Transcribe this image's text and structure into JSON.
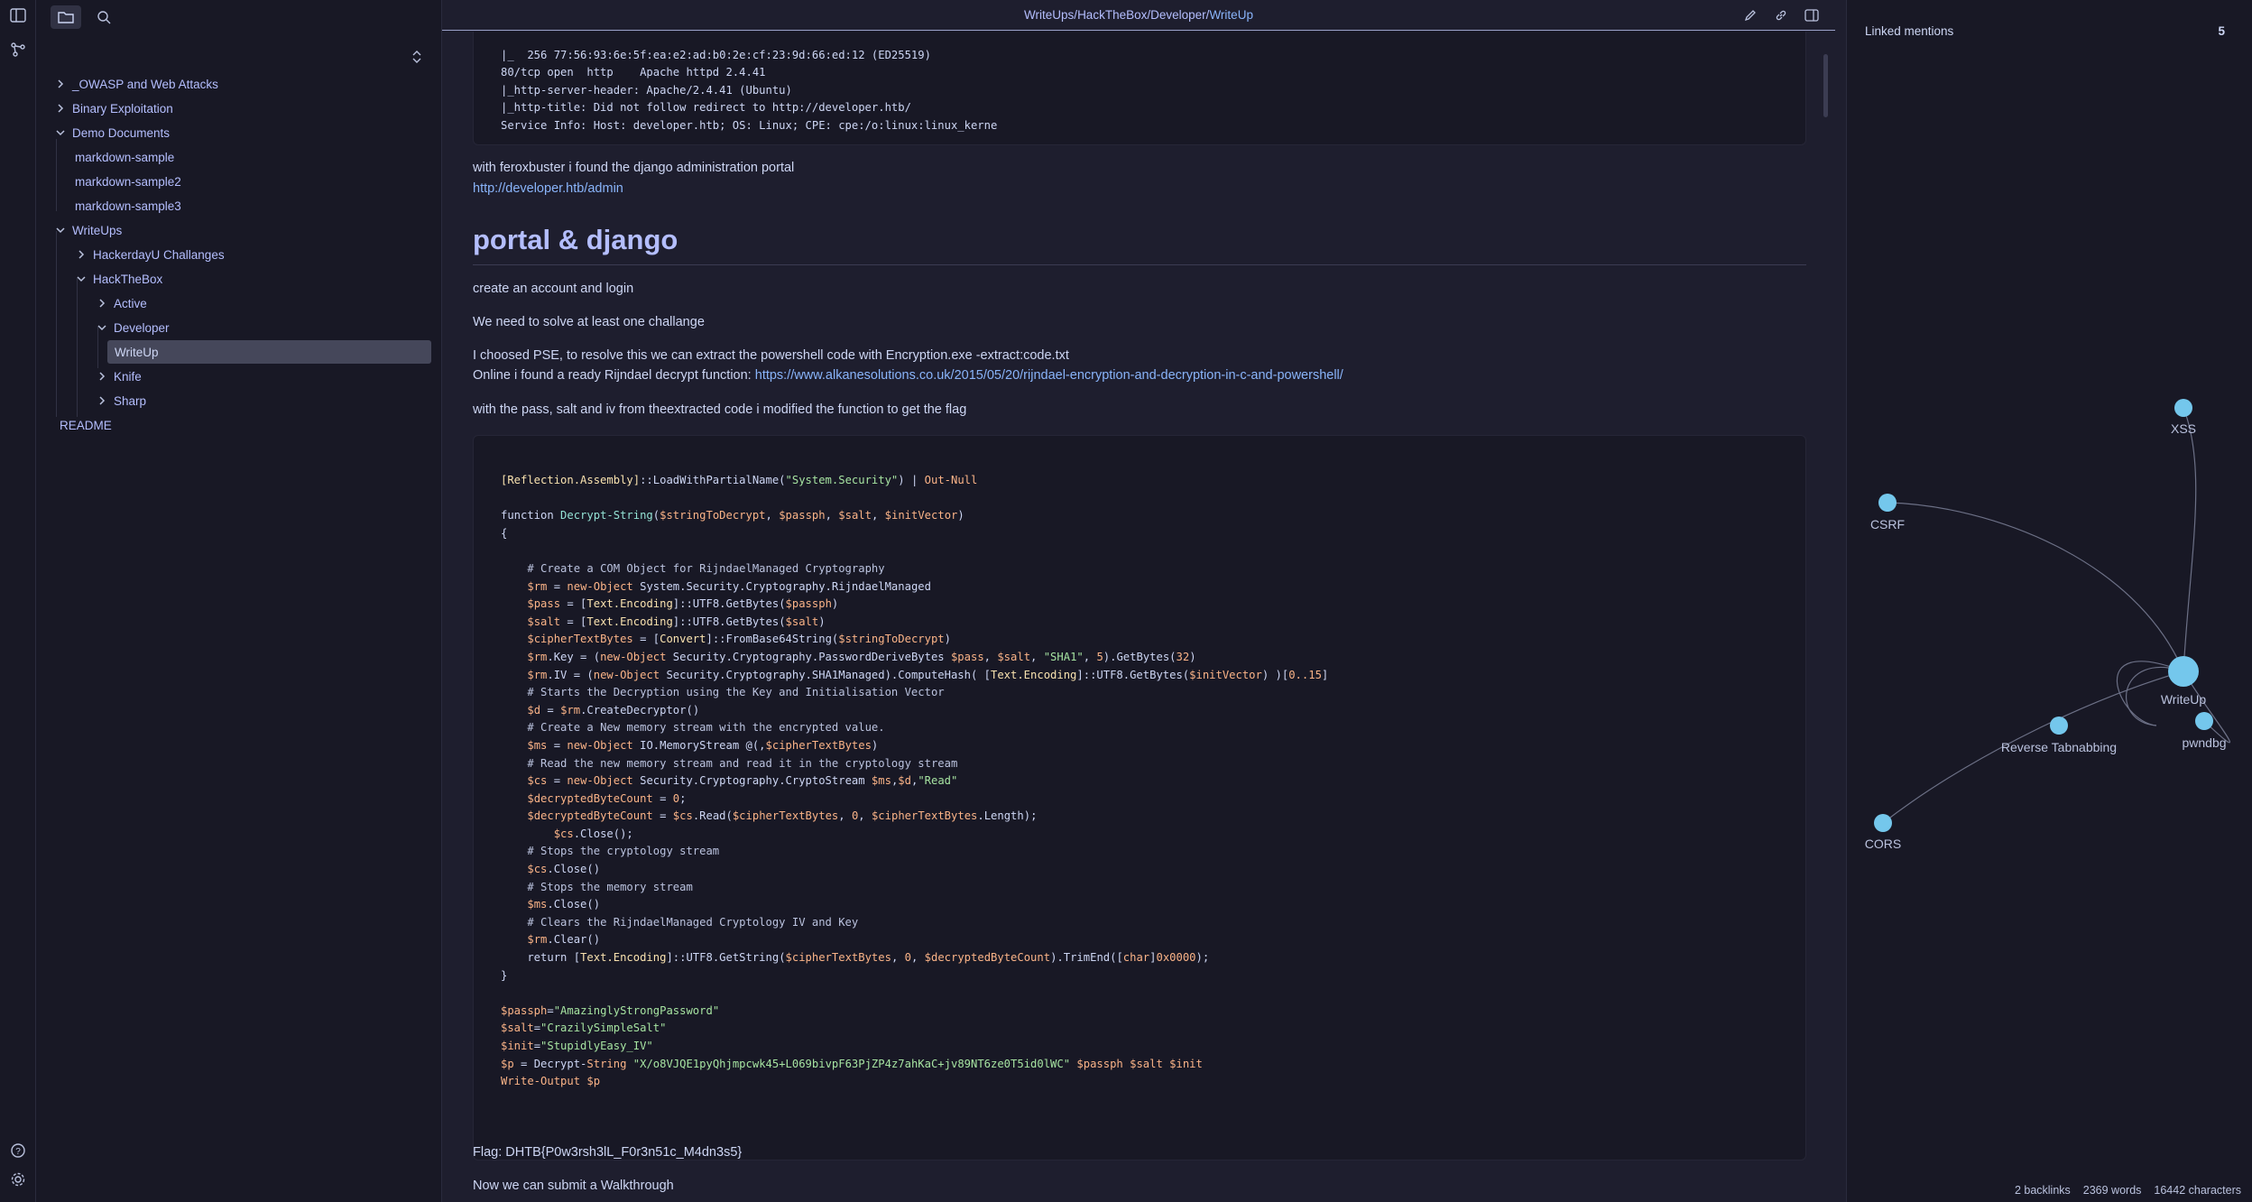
{
  "sidebar": {
    "tree": [
      {
        "label": "_OWASP and Web Attacks"
      },
      {
        "label": "Binary Exploitation"
      },
      {
        "label": "Demo Documents"
      },
      {
        "label": "markdown-sample"
      },
      {
        "label": "markdown-sample2"
      },
      {
        "label": "markdown-sample3"
      },
      {
        "label": "WriteUps"
      },
      {
        "label": "HackerdayU Challanges"
      },
      {
        "label": "HackTheBox"
      },
      {
        "label": "Active"
      },
      {
        "label": "Developer"
      },
      {
        "label": "WriteUp"
      },
      {
        "label": "Knife"
      },
      {
        "label": "Sharp"
      },
      {
        "label": "README"
      }
    ]
  },
  "breadcrumb": {
    "p1": "WriteUps",
    "p2": "HackTheBox",
    "p3": "Developer",
    "current": "WriteUp",
    "sep": " / "
  },
  "doc": {
    "nmap_lines": [
      "|_  256 77:56:93:6e:5f:ea:e2:ad:b0:2e:cf:23:9d:66:ed:12 (ED25519)",
      "80/tcp open  http    Apache httpd 2.4.41",
      "|_http-server-header: Apache/2.4.41 (Ubuntu)",
      "|_http-title: Did not follow redirect to http://developer.htb/",
      "Service Info: Host: developer.htb; OS: Linux; CPE: cpe:/o:linux:linux_kerne"
    ],
    "p_ferox": "with feroxbuster i found the django administration portal",
    "link_admin": "http://developer.htb/admin",
    "heading": "portal & django",
    "p_account": "create an account and login",
    "p_challange": "We need to solve at least one challange",
    "p_pse": "I choosed PSE, to resolve this we can extract the powershell code with Encryption.exe -extract:code.txt",
    "p_online": "Online i found a ready Rijndael decrypt function: ",
    "link_alkane": "https://www.alkanesolutions.co.uk/2015/05/20/rijndael-encryption-and-decryption-in-c-and-powershell/",
    "p_pass": "with the pass, salt and iv from theextracted code i modified the function to get the flag",
    "p_flag": "Flag: DHTB{P0w3rsh3lL_F0r3n51c_M4dn3s5}",
    "p_walk": "Now we can submit a Walkthrough"
  },
  "right_panel": {
    "title": "Linked mentions",
    "count": "5",
    "nodes": [
      "XSS",
      "CSRF",
      "WriteUp",
      "Reverse Tabnabbing",
      "pwndbg",
      "CORS"
    ],
    "status_backlinks": "2 backlinks",
    "status_words": "2369 words",
    "status_chars": "16442 characters"
  },
  "colors": {
    "accent": "#89b4fa",
    "node": "#74c7ec",
    "background": "#1e1e2e",
    "panel": "#181825"
  }
}
